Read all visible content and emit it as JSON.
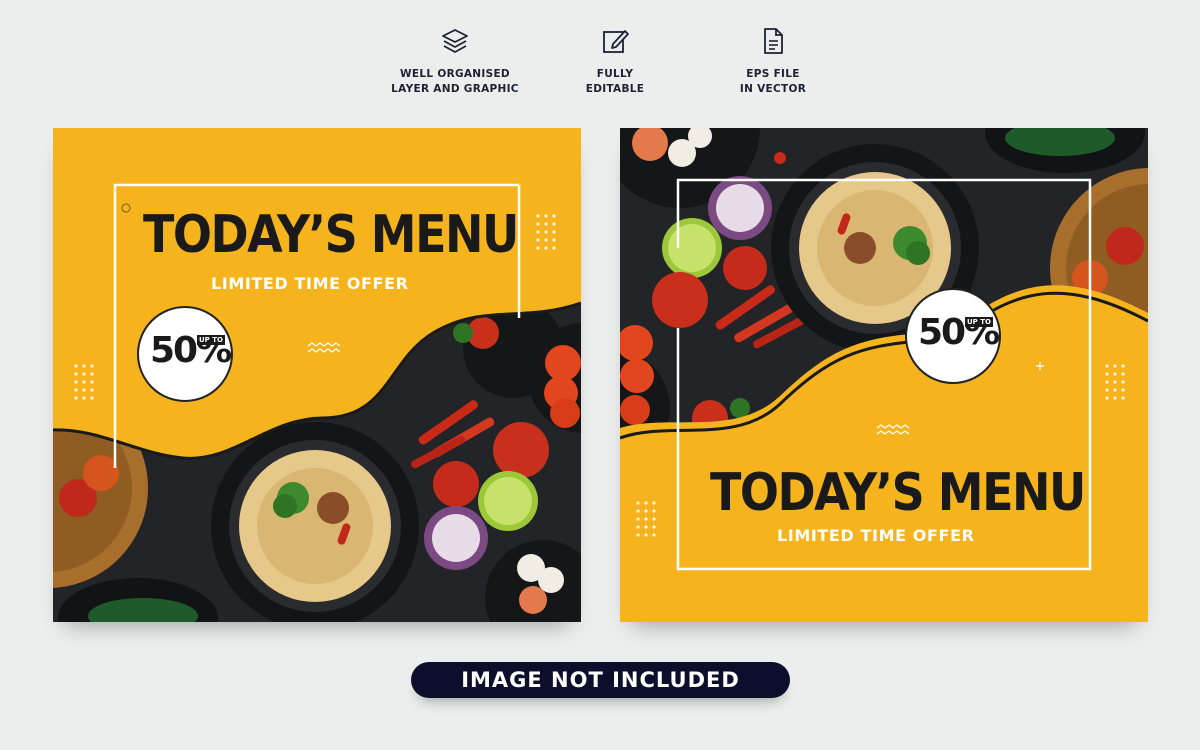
{
  "features": [
    {
      "icon": "layers-icon",
      "line1": "WELL ORGANISED",
      "line2": "LAYER AND GRAPHIC"
    },
    {
      "icon": "edit-icon",
      "line1": "FULLY",
      "line2": "EDITABLE"
    },
    {
      "icon": "document-icon",
      "line1": "EPS FILE",
      "line2": "IN VECTOR"
    }
  ],
  "cards": [
    {
      "headline": "TODAY’S MENU",
      "subline": "LIMITED TIME OFFER",
      "discount": "50%",
      "discount_prefix": "UP TO"
    },
    {
      "headline": "TODAY’S MENU",
      "subline": "LIMITED TIME OFFER",
      "discount": "50%",
      "discount_prefix": "UP TO"
    }
  ],
  "footer": {
    "label": "IMAGE NOT INCLUDED"
  },
  "colors": {
    "accent_yellow": "#f5b41d",
    "dark": "#232427",
    "pill": "#0b0f2b",
    "text_dark": "#1a1a1a"
  }
}
